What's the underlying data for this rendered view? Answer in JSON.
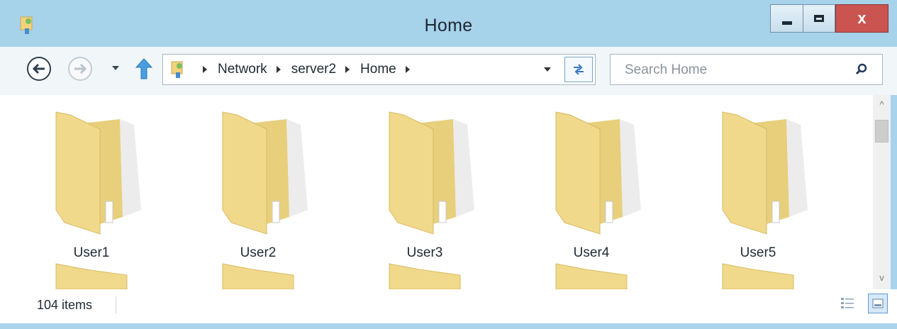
{
  "window": {
    "title": "Home",
    "controls": {
      "minimize": "minimize",
      "maximize": "maximize",
      "close": "x"
    }
  },
  "navigation": {
    "breadcrumbs": [
      "Network",
      "server2",
      "Home"
    ]
  },
  "search": {
    "placeholder": "Search Home"
  },
  "items": [
    {
      "label": "User1",
      "icon": "folder-icon"
    },
    {
      "label": "User2",
      "icon": "folder-icon"
    },
    {
      "label": "User3",
      "icon": "folder-icon"
    },
    {
      "label": "User4",
      "icon": "folder-icon"
    },
    {
      "label": "User5",
      "icon": "folder-icon"
    }
  ],
  "status": {
    "item_count": "104 items"
  },
  "colors": {
    "frame": "#a9d3ea",
    "close_button": "#c95450",
    "folder": "#f1d98c"
  }
}
